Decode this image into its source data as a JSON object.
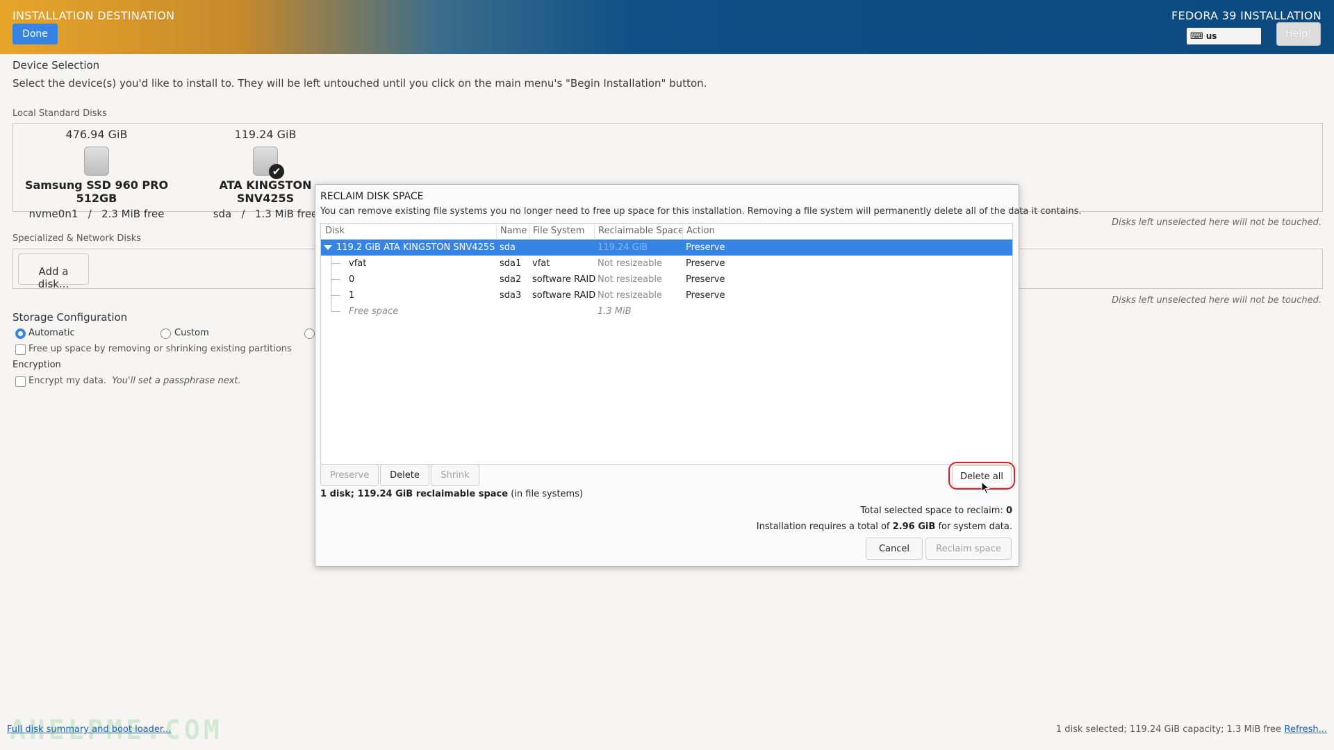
{
  "header": {
    "title": "INSTALLATION DESTINATION",
    "done_label": "Done",
    "product_title": "FEDORA 39 INSTALLATION",
    "keyboard_layout": "us",
    "keyboard_icon": "keyboard-icon",
    "help_label": "Help!",
    "gradient_colors": [
      "#e7a52a",
      "#0c4a80"
    ]
  },
  "device_selection": {
    "heading": "Device Selection",
    "instructions": "Select the device(s) you'd like to install to.  They will be left untouched until you click on the main menu's \"Begin Installation\" button.",
    "local_heading": "Local Standard Disks",
    "disks": [
      {
        "size": "476.94 GiB",
        "name": "Samsung SSD 960 PRO 512GB",
        "device": "nvme0n1",
        "sep": "/",
        "free": "2.3 MiB free",
        "selected": false
      },
      {
        "size": "119.24 GiB",
        "name": "ATA KINGSTON SNV425S",
        "device": "sda",
        "sep": "/",
        "free": "1.3 MiB free",
        "selected": true
      }
    ],
    "untouched_note": "Disks left unselected here will not be touched.",
    "network_heading": "Specialized & Network Disks",
    "add_disk_label": "Add a disk...",
    "network_note": "Disks left unselected here will not be touched."
  },
  "storage_config": {
    "heading": "Storage Configuration",
    "automatic_label": "Automatic",
    "custom_label": "Custom",
    "free_up_label": "Free up space by removing or shrinking existing partitions",
    "encryption_heading": "Encryption",
    "encrypt_label": "Encrypt my data.",
    "encrypt_hint": "You'll set a passphrase next."
  },
  "footer": {
    "summary_link": "Full disk summary and boot loader...",
    "status": "1 disk selected; 119.24 GiB capacity; 1.3 MiB free",
    "refresh_link": "Refresh...",
    "watermark": "AHELPME.COM"
  },
  "dialog": {
    "title": "RECLAIM DISK SPACE",
    "description": "You can remove existing file systems you no longer need to free up space for this installation.  Removing a file system will permanently delete all of the data it contains.",
    "columns": [
      "Disk",
      "Name",
      "File System",
      "Reclaimable Space",
      "Action"
    ],
    "rows": [
      {
        "disk": "119.2 GiB ATA KINGSTON SNV425S",
        "name": "sda",
        "fs": "",
        "space": "119.24 GiB",
        "action": "Preserve"
      },
      {
        "disk": "vfat",
        "name": "sda1",
        "fs": "vfat",
        "space": "Not resizeable",
        "action": "Preserve"
      },
      {
        "disk": "0",
        "name": "sda2",
        "fs": "software RAID",
        "space": "Not resizeable",
        "action": "Preserve"
      },
      {
        "disk": "1",
        "name": "sda3",
        "fs": "software RAID",
        "space": "Not resizeable",
        "action": "Preserve"
      },
      {
        "disk": "Free space",
        "name": "",
        "fs": "",
        "space": "1.3 MiB",
        "action": ""
      }
    ],
    "preserve_label": "Preserve",
    "delete_label": "Delete",
    "shrink_label": "Shrink",
    "delete_all_label": "Delete all",
    "summary_bold": "1 disk; 119.24 GiB reclaimable space",
    "summary_rest": "(in file systems)",
    "total_label": "Total selected space to reclaim:",
    "total_value": "0",
    "requires_prefix": "Installation requires a total of",
    "requires_value": "2.96 GiB",
    "requires_suffix": "for system data.",
    "cancel_label": "Cancel",
    "reclaim_label": "Reclaim space",
    "highlight_color": "#e01b24",
    "selection_color": "#3584e4"
  }
}
